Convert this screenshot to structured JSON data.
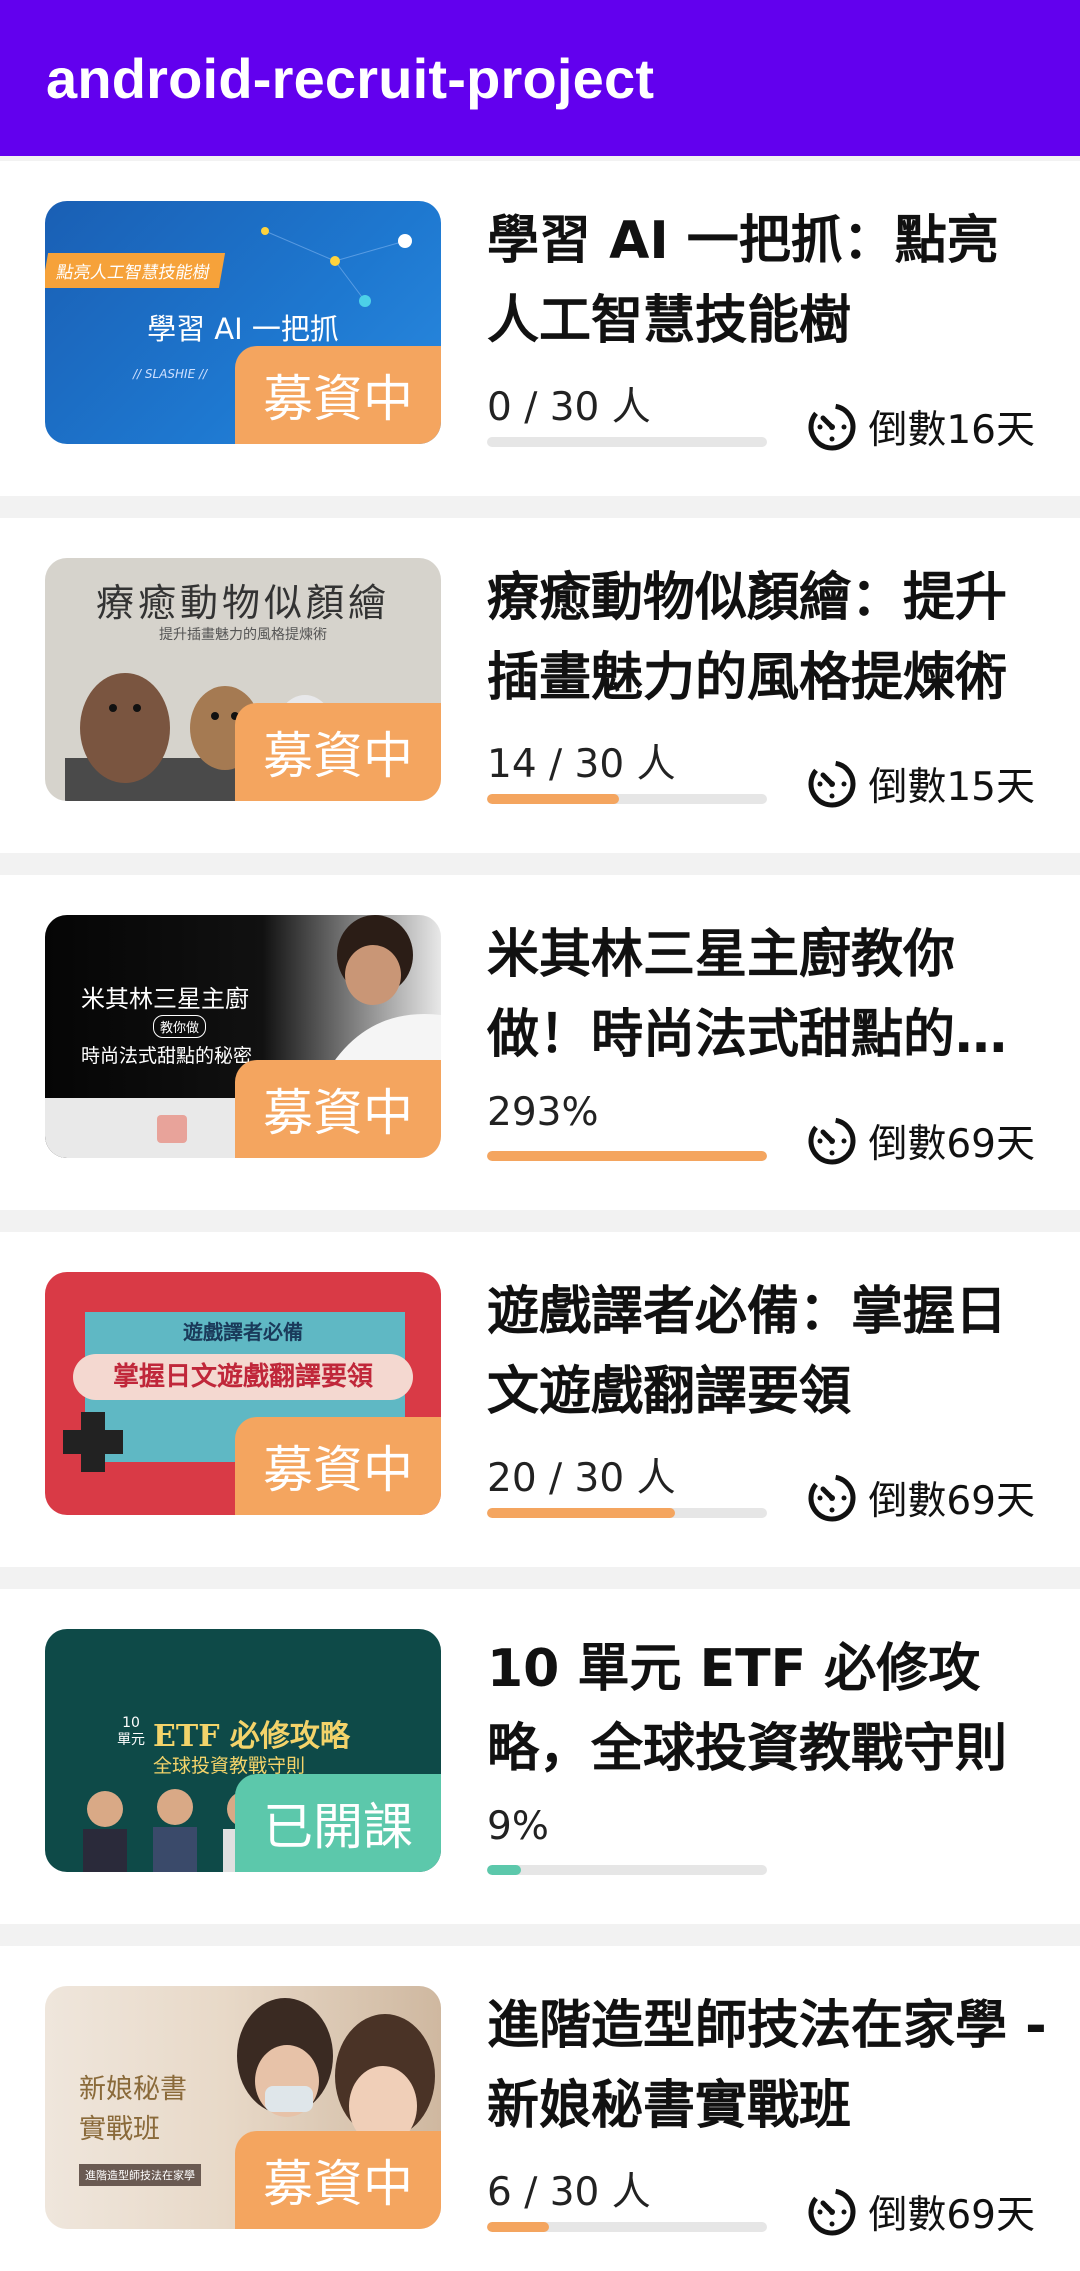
{
  "appbar": {
    "title": "android-recruit-project"
  },
  "colors": {
    "primary": "#6200ee",
    "funding": "#f4a55f",
    "started": "#5cc8ab",
    "track": "#e6e6e6"
  },
  "courses": [
    {
      "title": "學習 AI 一把抓：點亮人工智慧技能樹",
      "thumb_lines": [
        "點亮人工智慧技能樹",
        "學習 AI 一把抓",
        "// SLASHIE //"
      ],
      "badge": "募資中",
      "status": "funding",
      "progress_text": "0 / 30 人",
      "progress": 0.0,
      "countdown": "倒數16天"
    },
    {
      "title": "療癒動物似顏繪：提升插畫魅力的風格提煉術",
      "thumb_lines": [
        "療癒動物似顏繪",
        "提升插畫魅力的風格提煉術"
      ],
      "badge": "募資中",
      "status": "funding",
      "progress_text": "14 / 30 人",
      "progress": 0.47,
      "countdown": "倒數15天"
    },
    {
      "title": "米其林三星主廚教你做！時尚法式甜點的秘密",
      "thumb_lines": [
        "米其林三星主廚",
        "教你做",
        "時尚法式甜點的秘密"
      ],
      "badge": "募資中",
      "status": "funding",
      "progress_text": "293%",
      "progress": 1.0,
      "countdown": "倒數69天"
    },
    {
      "title": "遊戲譯者必備：掌握日文遊戲翻譯要領",
      "thumb_lines": [
        "遊戲譯者必備",
        "掌握日文遊戲翻譯要領"
      ],
      "badge": "募資中",
      "status": "funding",
      "progress_text": "20 / 30 人",
      "progress": 0.67,
      "countdown": "倒數69天"
    },
    {
      "title": "10 單元 ETF 必修攻略，全球投資教戰守則",
      "thumb_lines": [
        "ETF 必修攻略",
        "全球投資教戰守則",
        "10單元"
      ],
      "badge": "已開課",
      "status": "started",
      "progress_text": "9%",
      "progress": 0.12,
      "countdown": ""
    },
    {
      "title": "進階造型師技法在家學 - 新娘秘書實戰班",
      "thumb_lines": [
        "新娘秘書",
        "實戰班",
        "進階造型師技法在家學"
      ],
      "badge": "募資中",
      "status": "funding",
      "progress_text": "6 / 30 人",
      "progress": 0.22,
      "countdown": "倒數69天"
    }
  ]
}
